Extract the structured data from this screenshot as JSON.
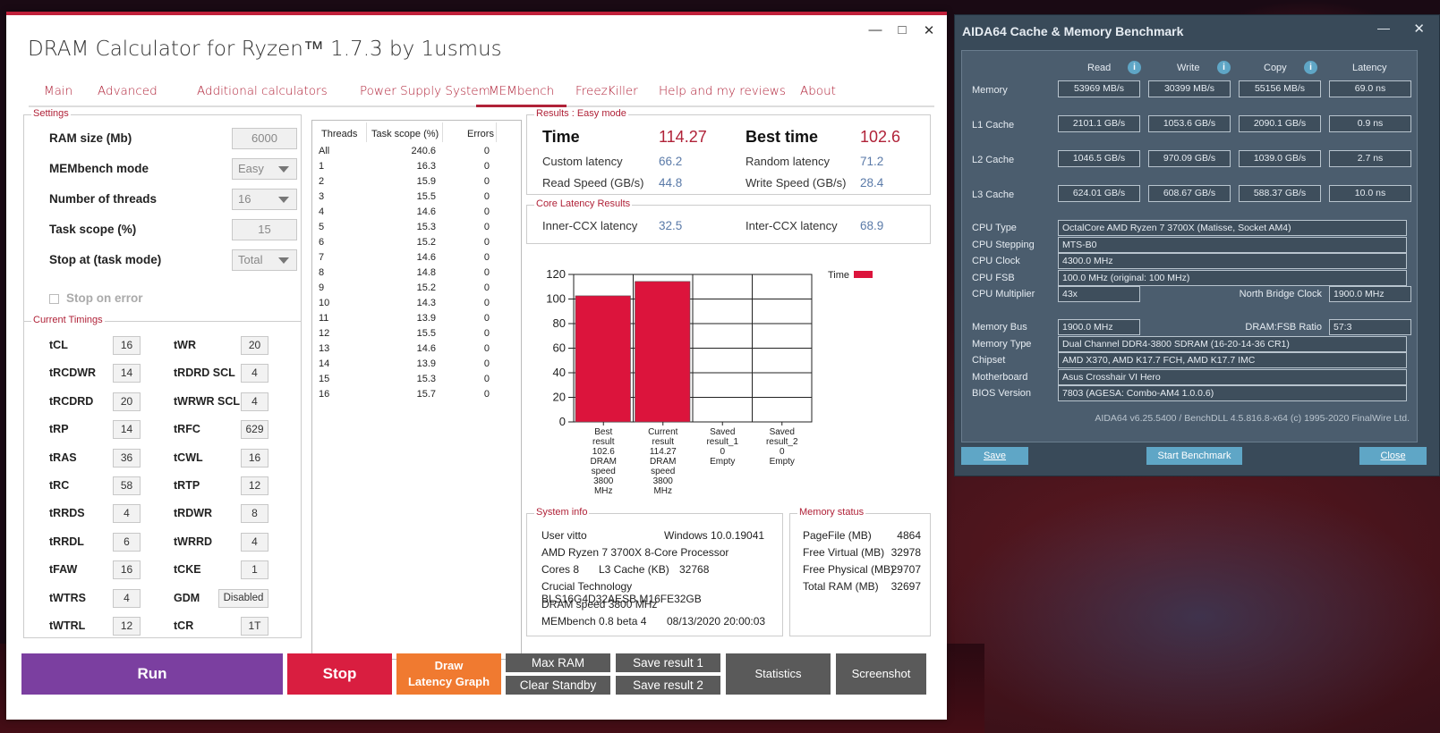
{
  "dram": {
    "title": "DRAM Calculator for Ryzen™ 1.7.3 by 1usmus",
    "win": {
      "min": "—",
      "max": "□",
      "close": "✕"
    },
    "tabs": [
      "Main",
      "Advanced",
      "Additional calculators",
      "Power Supply System",
      "MEMbench",
      "FreezKiller",
      "Help and my reviews",
      "About"
    ],
    "settings": {
      "label": "Settings",
      "ram_label": "RAM size (Mb)",
      "ram_value": "6000",
      "mode_label": "MEMbench mode",
      "mode_value": "Easy",
      "threads_label": "Number of threads",
      "threads_value": "16",
      "scope_label": "Task scope (%)",
      "scope_value": "15",
      "stop_label": "Stop at (task mode)",
      "stop_value": "Total",
      "stop_on_error": "Stop on error"
    },
    "timings": {
      "label": "Current Timings",
      "left": [
        {
          "n": "tCL",
          "v": "16"
        },
        {
          "n": "tRCDWR",
          "v": "14"
        },
        {
          "n": "tRCDRD",
          "v": "20"
        },
        {
          "n": "tRP",
          "v": "14"
        },
        {
          "n": "tRAS",
          "v": "36"
        },
        {
          "n": "tRC",
          "v": "58"
        },
        {
          "n": "tRRDS",
          "v": "4"
        },
        {
          "n": "tRRDL",
          "v": "6"
        },
        {
          "n": "tFAW",
          "v": "16"
        },
        {
          "n": "tWTRS",
          "v": "4"
        },
        {
          "n": "tWTRL",
          "v": "12"
        }
      ],
      "right": [
        {
          "n": "tWR",
          "v": "20"
        },
        {
          "n": "tRDRD SCL",
          "v": "4"
        },
        {
          "n": "tWRWR SCL",
          "v": "4"
        },
        {
          "n": "tRFC",
          "v": "629"
        },
        {
          "n": "tCWL",
          "v": "16"
        },
        {
          "n": "tRTP",
          "v": "12"
        },
        {
          "n": "tRDWR",
          "v": "8"
        },
        {
          "n": "tWRRD",
          "v": "4"
        },
        {
          "n": "tCKE",
          "v": "1"
        },
        {
          "n": "GDM",
          "v": "Disabled"
        },
        {
          "n": "tCR",
          "v": "1T"
        }
      ]
    },
    "threads": {
      "h1": "Threads",
      "h2": "Task scope (%)",
      "h3": "Errors",
      "rows": [
        [
          "All",
          "240.6",
          "0"
        ],
        [
          "1",
          "16.3",
          "0"
        ],
        [
          "2",
          "15.9",
          "0"
        ],
        [
          "3",
          "15.5",
          "0"
        ],
        [
          "4",
          "14.6",
          "0"
        ],
        [
          "5",
          "15.3",
          "0"
        ],
        [
          "6",
          "15.2",
          "0"
        ],
        [
          "7",
          "14.6",
          "0"
        ],
        [
          "8",
          "14.8",
          "0"
        ],
        [
          "9",
          "15.2",
          "0"
        ],
        [
          "10",
          "14.3",
          "0"
        ],
        [
          "11",
          "13.9",
          "0"
        ],
        [
          "12",
          "15.5",
          "0"
        ],
        [
          "13",
          "14.6",
          "0"
        ],
        [
          "14",
          "13.9",
          "0"
        ],
        [
          "15",
          "15.3",
          "0"
        ],
        [
          "16",
          "15.7",
          "0"
        ]
      ]
    },
    "results": {
      "label": "Results : Easy mode",
      "time_l": "Time",
      "time_v": "114.27",
      "best_l": "Best time",
      "best_v": "102.6",
      "custom_l": "Custom latency",
      "custom_v": "66.2",
      "random_l": "Random latency",
      "random_v": "71.2",
      "read_l": "Read Speed (GB/s)",
      "read_v": "44.8",
      "write_l": "Write Speed (GB/s)",
      "write_v": "28.4"
    },
    "core": {
      "label": "Core Latency Results",
      "inner_l": "Inner-CCX latency",
      "inner_v": "32.5",
      "inter_l": "Inter-CCX latency",
      "inter_v": "68.9"
    },
    "system": {
      "label": "System info",
      "user": "User vitto",
      "os": "Windows 10.0.19041",
      "cpu": "AMD Ryzen 7 3700X 8-Core Processor",
      "cores": "Cores 8",
      "l3": "L3 Cache (KB)",
      "l3v": "32768",
      "ram": "Crucial Technology BLS16G4D32AESB.M16FE32GB",
      "speed": "DRAM speed 3800 MHz",
      "mb": "MEMbench 0.8 beta 4",
      "date": "08/13/2020 20:00:03"
    },
    "memory": {
      "label": "Memory status",
      "rows": [
        [
          "PageFile (MB)",
          "4864"
        ],
        [
          "Free Virtual (MB)",
          "32978"
        ],
        [
          "Free Physical (MB)",
          "29707"
        ],
        [
          "Total RAM (MB)",
          "32697"
        ]
      ]
    },
    "buttons": {
      "run": "Run",
      "stop": "Stop",
      "draw1": "Draw",
      "draw2": "Latency Graph",
      "maxram": "Max RAM",
      "clear": "Clear Standby",
      "save1": "Save result 1",
      "save2": "Save result 2",
      "stats": "Statistics",
      "shot": "Screenshot"
    },
    "colors": {
      "accent": "#b02238",
      "run": "#7b3fa0",
      "stop": "#d91e40",
      "draw": "#f07a30",
      "gray": "#5a5a5a"
    }
  },
  "chart_data": {
    "type": "bar",
    "legend": "Time",
    "legend_position": "top-right",
    "ylim": [
      0,
      120
    ],
    "yticks": [
      "0",
      "20",
      "40",
      "60",
      "80",
      "100",
      "120"
    ],
    "categories": [
      [
        "Best",
        "result",
        "102.6",
        "DRAM",
        "speed",
        "3800",
        "MHz"
      ],
      [
        "Current",
        "result",
        "114.27",
        "DRAM",
        "speed",
        "3800",
        "MHz"
      ],
      [
        "Saved",
        "result_1",
        "0",
        "Empty"
      ],
      [
        "Saved",
        "result_2",
        "0",
        "Empty"
      ]
    ],
    "values": [
      102.6,
      114.27,
      0,
      0
    ],
    "color": "#dc143c",
    "grid": true
  },
  "aida": {
    "title": "AIDA64 Cache & Memory Benchmark",
    "win": {
      "min": "—",
      "close": "✕"
    },
    "cols": [
      "Read",
      "Write",
      "Copy",
      "Latency"
    ],
    "rows": [
      {
        "n": "Memory",
        "v": [
          "53969 MB/s",
          "30399 MB/s",
          "55156 MB/s",
          "69.0 ns"
        ]
      },
      {
        "n": "L1 Cache",
        "v": [
          "2101.1 GB/s",
          "1053.6 GB/s",
          "2090.1 GB/s",
          "0.9 ns"
        ]
      },
      {
        "n": "L2 Cache",
        "v": [
          "1046.5 GB/s",
          "970.09 GB/s",
          "1039.0 GB/s",
          "2.7 ns"
        ]
      },
      {
        "n": "L3 Cache",
        "v": [
          "624.01 GB/s",
          "608.67 GB/s",
          "588.37 GB/s",
          "10.0 ns"
        ]
      }
    ],
    "info": {
      "cpu_type_l": "CPU Type",
      "cpu_type": "OctalCore AMD Ryzen 7 3700X  (Matisse, Socket AM4)",
      "step_l": "CPU Stepping",
      "step": "MTS-B0",
      "clock_l": "CPU Clock",
      "clock": "4300.0 MHz",
      "fsb_l": "CPU FSB",
      "fsb": "100.0 MHz  (original: 100 MHz)",
      "mult_l": "CPU Multiplier",
      "mult": "43x",
      "nb_l": "North Bridge Clock",
      "nb": "1900.0 MHz",
      "bus_l": "Memory Bus",
      "bus": "1900.0 MHz",
      "ratio_l": "DRAM:FSB Ratio",
      "ratio": "57:3",
      "type_l": "Memory Type",
      "type": "Dual Channel DDR4-3800 SDRAM  (16-20-14-36 CR1)",
      "chip_l": "Chipset",
      "chip": "AMD X370, AMD K17.7 FCH, AMD K17.7 IMC",
      "mobo_l": "Motherboard",
      "mobo": "Asus Crosshair VI Hero",
      "bios_l": "BIOS Version",
      "bios": "7803  (AGESA: Combo-AM4 1.0.0.6)"
    },
    "footer": "AIDA64 v6.25.5400 / BenchDLL 4.5.816.8-x64  (c) 1995-2020 FinalWire Ltd.",
    "buttons": {
      "save": "Save",
      "start": "Start Benchmark",
      "close": "Close"
    }
  }
}
